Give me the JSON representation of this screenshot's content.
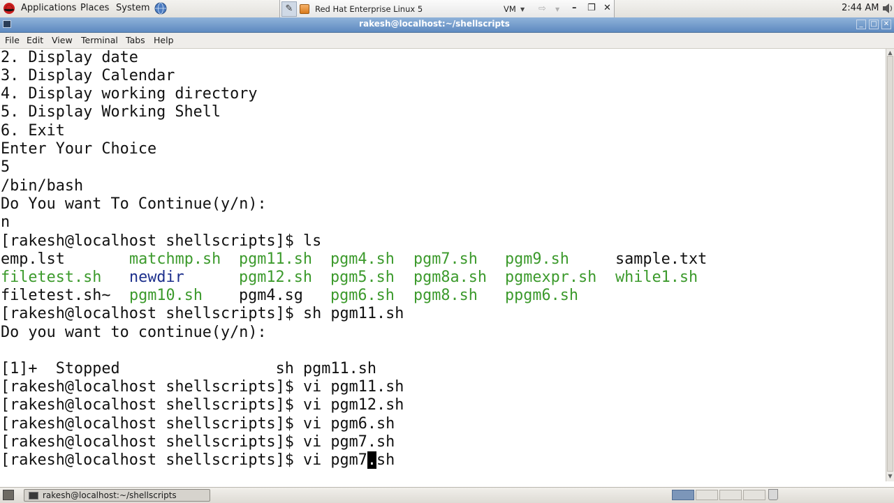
{
  "top_panel": {
    "applications": "Applications",
    "places": "Places",
    "system": "System",
    "clock": "2:44 AM"
  },
  "vm_bar": {
    "title": "Red Hat Enterprise Linux 5",
    "vm_label": "VM"
  },
  "window": {
    "title": "rakesh@localhost:~/shellscripts"
  },
  "menubar": {
    "file": "File",
    "edit": "Edit",
    "view": "View",
    "terminal": "Terminal",
    "tabs": "Tabs",
    "help": "Help"
  },
  "terminal": {
    "lines_top": [
      "2. Display date",
      "3. Display Calendar",
      "4. Display working directory",
      "5. Display Working Shell",
      "6. Exit",
      "Enter Your Choice",
      "5",
      "/bin/bash",
      "Do You want To Continue(y/n):",
      "n",
      "[rakesh@localhost shellscripts]$ ls"
    ],
    "ls_rows": [
      [
        {
          "name": "emp.lst",
          "color": "plain"
        },
        {
          "name": "matchmp.sh",
          "color": "green"
        },
        {
          "name": "pgm11.sh",
          "color": "green"
        },
        {
          "name": "pgm4.sh",
          "color": "green"
        },
        {
          "name": "pgm7.sh",
          "color": "green"
        },
        {
          "name": "pgm9.sh",
          "color": "green"
        },
        {
          "name": "sample.txt",
          "color": "plain"
        }
      ],
      [
        {
          "name": "filetest.sh",
          "color": "green"
        },
        {
          "name": "newdir",
          "color": "blue"
        },
        {
          "name": "pgm12.sh",
          "color": "green"
        },
        {
          "name": "pgm5.sh",
          "color": "green"
        },
        {
          "name": "pgm8a.sh",
          "color": "green"
        },
        {
          "name": "pgmexpr.sh",
          "color": "green"
        },
        {
          "name": "while1.sh",
          "color": "green"
        }
      ],
      [
        {
          "name": "filetest.sh~",
          "color": "plain"
        },
        {
          "name": "pgm10.sh",
          "color": "green"
        },
        {
          "name": "pgm4.sg",
          "color": "plain"
        },
        {
          "name": "pgm6.sh",
          "color": "green"
        },
        {
          "name": "pgm8.sh",
          "color": "green"
        },
        {
          "name": "ppgm6.sh",
          "color": "green"
        }
      ]
    ],
    "lines_bottom": [
      "[rakesh@localhost shellscripts]$ sh pgm11.sh",
      "Do you want to continue(y/n):",
      "",
      "[1]+  Stopped                 sh pgm11.sh",
      "[rakesh@localhost shellscripts]$ vi pgm11.sh",
      "[rakesh@localhost shellscripts]$ vi pgm12.sh",
      "[rakesh@localhost shellscripts]$ vi pgm6.sh",
      "[rakesh@localhost shellscripts]$ vi pgm7.sh"
    ],
    "last_line_before_cursor": "[rakesh@localhost shellscripts]$ vi pgm7",
    "cursor_char": ".",
    "last_line_after_cursor": "sh"
  },
  "taskbar": {
    "task_label": "rakesh@localhost:~/shellscripts"
  },
  "colors": {
    "executable": "#3c9a2c",
    "directory": "#1c2f8c",
    "titlebar": "#6f97c8"
  }
}
